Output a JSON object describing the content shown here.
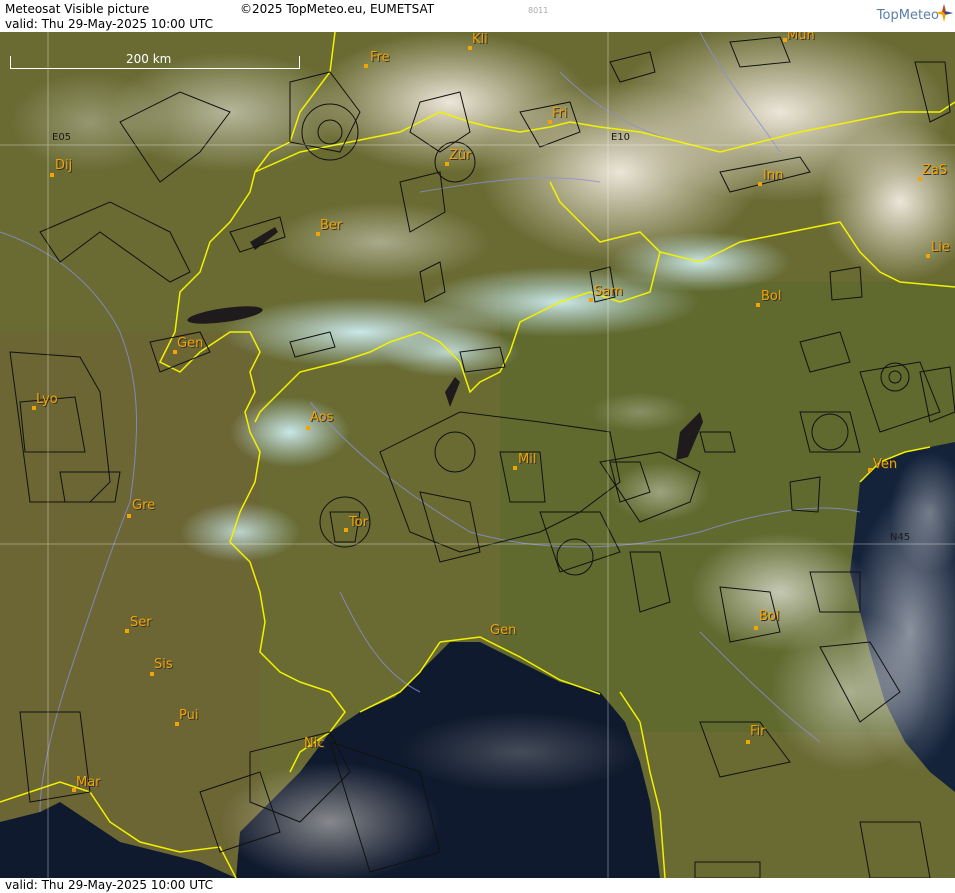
{
  "header": {
    "title": "Meteosat Visible picture",
    "valid_left": "valid:  Thu  29-May-2025  10:00 UTC",
    "copyright": "©2025 TopMeteo.eu, EUMETSAT",
    "code": "8011",
    "logo": "TopMeteo"
  },
  "footer": {
    "valid": "valid:  Thu  29-May-2025  10:00 UTC"
  },
  "map": {
    "scale_label": "200 km",
    "grid_labels": {
      "e05": "E05",
      "e10": "E10",
      "n45": "N45"
    },
    "cities": {
      "kli": "Kli",
      "mun": "Mun",
      "fre": "Fre",
      "fri": "Fri",
      "dij": "Dij",
      "zur": "Zür",
      "zas": "ZaS",
      "inn": "Inn",
      "ber": "Ber",
      "lie": "Lie",
      "sam": "Sam",
      "bol1": "Bol",
      "gen1": "Gen",
      "lyo": "Lyo",
      "aos": "Aos",
      "mil": "Mil",
      "ven": "Ven",
      "gre": "Gre",
      "tor": "Tor",
      "ser": "Ser",
      "bol2": "Bol",
      "gen2": "Gen",
      "sis": "Sis",
      "pui": "Pui",
      "fir": "Fir",
      "nic": "Nic",
      "mar": "Mar"
    },
    "icons": {
      "logo_mark": "compass-star-icon"
    }
  }
}
